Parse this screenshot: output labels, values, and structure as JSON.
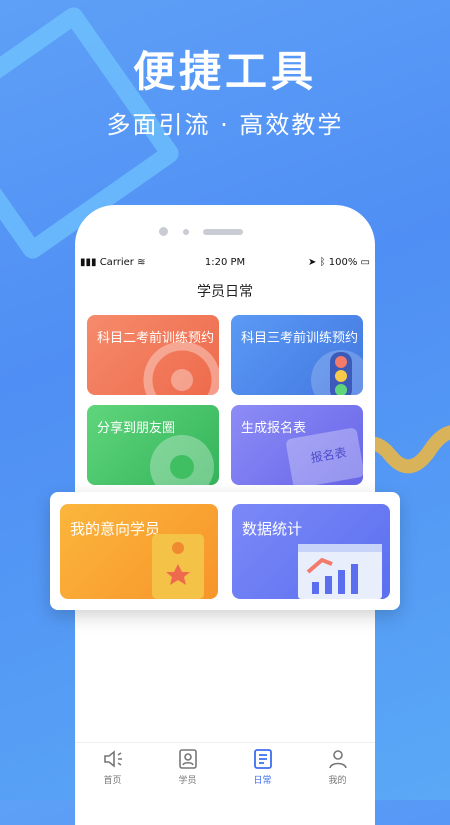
{
  "hero": {
    "title": "便捷工具",
    "subtitle": "多面引流 · 高效教学"
  },
  "status": {
    "carrier": "Carrier",
    "time": "1:20 PM",
    "battery": "100%"
  },
  "page": {
    "title": "学员日常"
  },
  "cards": [
    {
      "label": "科目二考前训练预约",
      "color": "#ee6a4c"
    },
    {
      "label": "科目三考前训练预约",
      "color": "#4377e0"
    },
    {
      "label": "分享到朋友圈",
      "color": "#34b35a"
    },
    {
      "label": "生成报名表",
      "color": "#6765e8",
      "badge": "报名表"
    }
  ],
  "featured": [
    {
      "label": "我的意向学员",
      "color": "#f7942a"
    },
    {
      "label": "数据统计",
      "color": "#5a6ff0"
    }
  ],
  "tabs": [
    {
      "label": "首页",
      "icon": "speaker-icon"
    },
    {
      "label": "学员",
      "icon": "student-card-icon"
    },
    {
      "label": "日常",
      "icon": "document-icon",
      "active": true
    },
    {
      "label": "我的",
      "icon": "user-icon"
    }
  ]
}
